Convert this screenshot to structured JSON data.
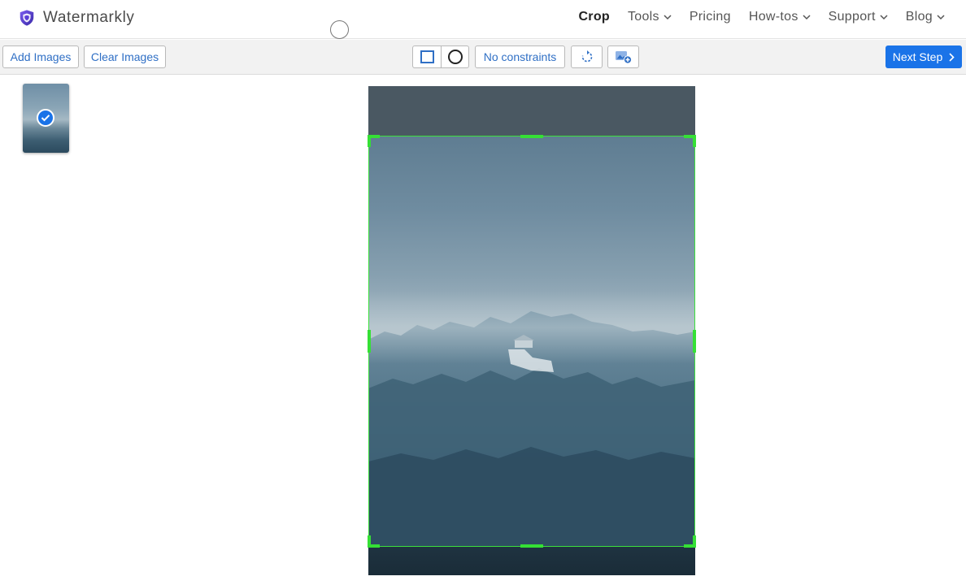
{
  "app": {
    "name": "Watermarkly",
    "brand_color": "#5b3fd6"
  },
  "nav": {
    "items": [
      {
        "label": "Crop",
        "active": true,
        "dropdown": false
      },
      {
        "label": "Tools",
        "active": false,
        "dropdown": true
      },
      {
        "label": "Pricing",
        "active": false,
        "dropdown": false
      },
      {
        "label": "How-tos",
        "active": false,
        "dropdown": true
      },
      {
        "label": "Support",
        "active": false,
        "dropdown": true
      },
      {
        "label": "Blog",
        "active": false,
        "dropdown": true
      }
    ]
  },
  "toolbar": {
    "add_images_label": "Add Images",
    "clear_images_label": "Clear Images",
    "shape_options": [
      "rectangle-icon",
      "circle-icon"
    ],
    "selected_shape": "rectangle",
    "constraints_label": "No constraints",
    "rotate_icon": "rotate-icon",
    "add_image_icon": "add-image-icon",
    "next_label": "Next Step",
    "accent_color": "#1a73e8"
  },
  "thumbnails": [
    {
      "selected": true
    }
  ],
  "crop": {
    "handle_color": "#35e035"
  }
}
